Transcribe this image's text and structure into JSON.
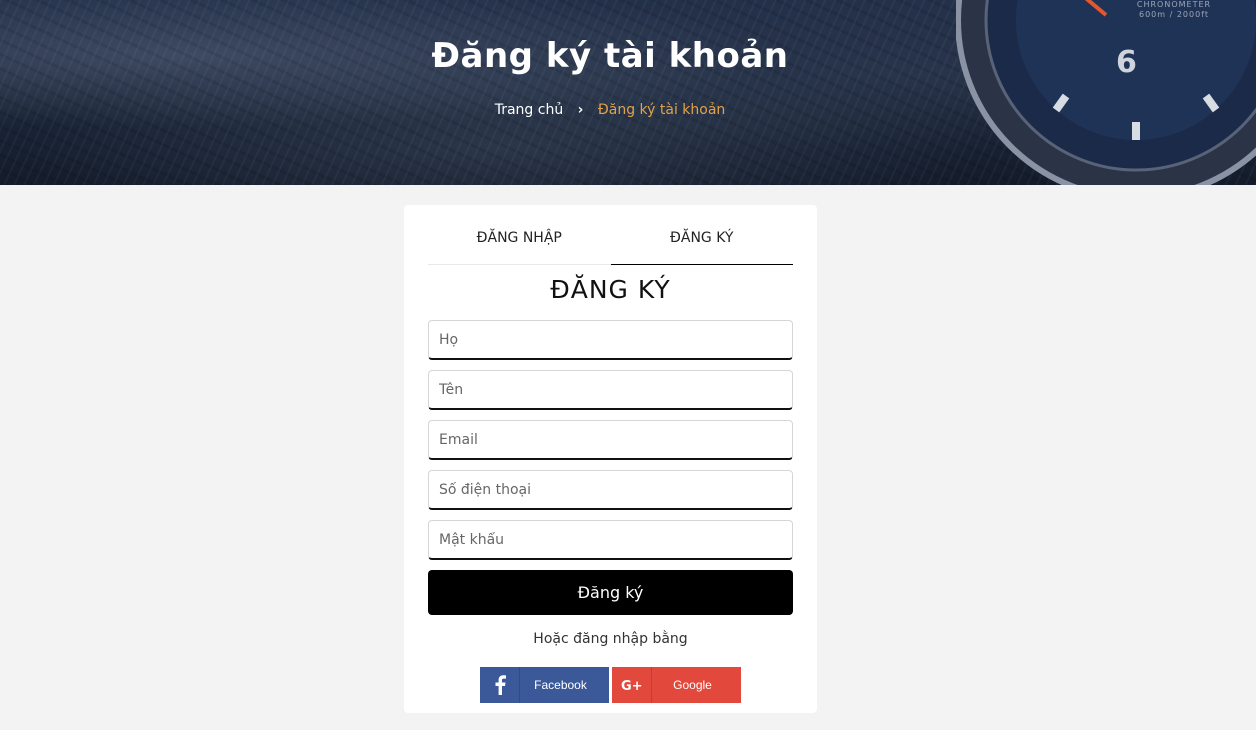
{
  "hero": {
    "title": "Đăng ký tài khoản",
    "watch_line1": "CHRONOMETER",
    "watch_line2": "600m / 2000ft",
    "watch_numeral": "6"
  },
  "breadcrumb": {
    "home": "Trang chủ",
    "separator": "›",
    "current": "Đăng ký tài khoản"
  },
  "tabs": {
    "login": "ĐĂNG NHẬP",
    "register": "ĐĂNG KÝ"
  },
  "form": {
    "title": "ĐĂNG KÝ",
    "fields": [
      {
        "placeholder": "Họ",
        "value": ""
      },
      {
        "placeholder": "Tên",
        "value": ""
      },
      {
        "placeholder": "Email",
        "value": ""
      },
      {
        "placeholder": "Số điện thoại",
        "value": ""
      },
      {
        "placeholder": "Mật khẩu",
        "value": ""
      }
    ],
    "submit_label": "Đăng ký",
    "alt_login_text": "Hoặc đăng nhập bằng"
  },
  "social": {
    "facebook": {
      "label": "Facebook",
      "icon": "facebook-icon",
      "color": "#3b5998"
    },
    "google": {
      "label": "Google",
      "icon": "google-plus-icon",
      "color": "#e2493c"
    }
  },
  "colors": {
    "accent": "#e0a24a",
    "button": "#000000",
    "page_bg": "#f3f3f3"
  }
}
